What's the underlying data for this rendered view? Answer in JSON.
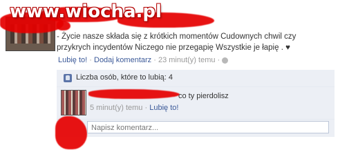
{
  "watermark": {
    "text": "www.wiocha.pl"
  },
  "post": {
    "text_line1": "- Życie nasze składa się z krótkich momentów Cudownych chwil czy",
    "text_line2": "przykrych incydentów Niczego nie przegapię Wszystkie je łapię . ♥",
    "like_label": "Lubię to!",
    "comment_label": "Dodaj komentarz",
    "time": "23 minut(y) temu",
    "sep": "·"
  },
  "likes": {
    "text": "Liczba osób, które to lubią: 4"
  },
  "comment": {
    "text": "co ty pierdolisz",
    "time": "5 minut(y) temu",
    "like_label": "Lubię to!",
    "sep": "·"
  },
  "composer": {
    "placeholder": "Napisz komentarz..."
  },
  "colors": {
    "link": "#3b5998",
    "scribble": "#e60000",
    "panel": "#eceff5"
  }
}
